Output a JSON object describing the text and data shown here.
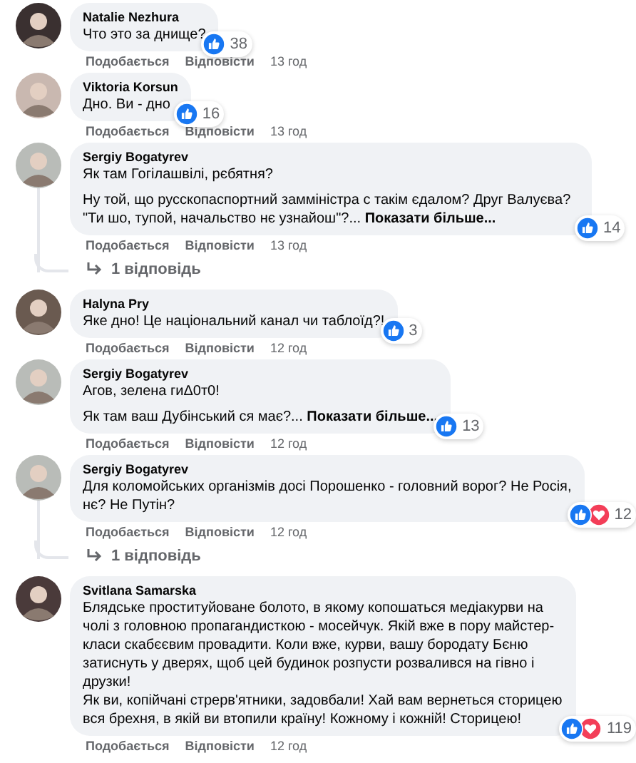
{
  "comments": [
    {
      "author": "Natalie Nezhura",
      "paragraphs": [
        "Что это за днище?"
      ],
      "reactions": {
        "like": true,
        "love": false,
        "count": "38"
      },
      "actions": {
        "like": "Подобається",
        "reply": "Відповісти",
        "time": "13 год"
      }
    },
    {
      "author": "Viktoria Korsun",
      "paragraphs": [
        "Дно. Ви - дно"
      ],
      "reactions": {
        "like": true,
        "love": false,
        "count": "16"
      },
      "actions": {
        "like": "Подобається",
        "reply": "Відповісти",
        "time": "13 год"
      }
    },
    {
      "author": "Sergiy Bogatyrev",
      "paragraphs": [
        "Як там Гогілашвілі, рєбятня?",
        "Ну той, що русскопаспортний замміністра с такім єдалом? Друг Валуєва? \"Ти шо, тупой, начальство нє узнайош\"?..."
      ],
      "see_more": "Показати більше...",
      "reactions": {
        "like": true,
        "love": false,
        "count": "14"
      },
      "actions": {
        "like": "Подобається",
        "reply": "Відповісти",
        "time": "13 год"
      },
      "replies": "1 відповідь"
    },
    {
      "author": "Halyna Pry",
      "paragraphs": [
        "Яке дно! Це національний канал чи таблоїд?!"
      ],
      "reactions": {
        "like": true,
        "love": false,
        "count": "3"
      },
      "actions": {
        "like": "Подобається",
        "reply": "Відповісти",
        "time": "12 год"
      }
    },
    {
      "author": "Sergiy Bogatyrev",
      "paragraphs": [
        "Агов, зелена гиΔ0т0!",
        "Як там ваш Дубінський ся має?..."
      ],
      "see_more": "Показати більше...",
      "reactions": {
        "like": true,
        "love": false,
        "count": "13"
      },
      "actions": {
        "like": "Подобається",
        "reply": "Відповісти",
        "time": "12 год"
      }
    },
    {
      "author": "Sergiy Bogatyrev",
      "paragraphs": [
        "Для коломойських організмів досі Порошенко - головний ворог? Не Росія, нє? Не Путін?"
      ],
      "reactions": {
        "like": true,
        "love": true,
        "count": "12"
      },
      "actions": {
        "like": "Подобається",
        "reply": "Відповісти",
        "time": "12 год"
      },
      "replies": "1 відповідь"
    },
    {
      "author": "Svitlana Samarska",
      "paragraphs": [
        "Блядське проституйоване болото, в якому копошаться медіакурви на чолі з головною пропагандисткою - мосейчук. Якій вже в пору майстер- класи скабєєвим провадити. Коли вже, курви, вашу бородату Бєню затиснуть у дверях, щоб цей будинок розпусти розвалився на гівно і друзки!\nЯк ви, копійчані стрерв'ятники, задовбали! Хай вам вернеться сторицею вся брехня, в якій ви втопили країну! Кожному і кожній! Сторицею!"
      ],
      "reactions": {
        "like": true,
        "love": true,
        "count": "119"
      },
      "actions": {
        "like": "Подобається",
        "reply": "Відповісти",
        "time": "12 год"
      }
    }
  ]
}
